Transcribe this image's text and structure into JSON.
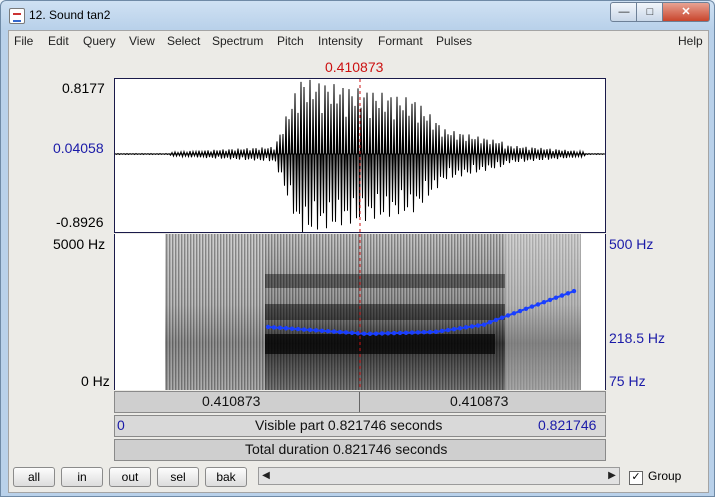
{
  "window": {
    "title": "12. Sound tan2",
    "minimize": "—",
    "maximize": "□",
    "close": "✕"
  },
  "menu": [
    "File",
    "Edit",
    "Query",
    "View",
    "Select",
    "Spectrum",
    "Pitch",
    "Intensity",
    "Formant",
    "Pulses"
  ],
  "help": "Help",
  "cursor_time": "0.410873",
  "waveform": {
    "top": "0.8177",
    "middle": "0.04058",
    "bottom": "-0.8926"
  },
  "spectrogram": {
    "top_left": "5000 Hz",
    "bottom_left": "0 Hz",
    "top_right": "500 Hz",
    "mid_right": "218.5 Hz",
    "bottom_right": "75 Hz"
  },
  "selection_bar": {
    "left": "0.410873",
    "right": "0.410873"
  },
  "visible_bar": {
    "start": "0",
    "label": "Visible part 0.821746 seconds",
    "end": "0.821746"
  },
  "total_bar": {
    "label": "Total duration 0.821746 seconds"
  },
  "buttons": {
    "all": "all",
    "in": "in",
    "out": "out",
    "sel": "sel",
    "bak": "bak"
  },
  "group": {
    "label": "Group",
    "checked": "✓"
  },
  "colors": {
    "pitch": "#1a3fff",
    "cursor": "#cc1111",
    "labels_blue": "#1a1aa8"
  }
}
